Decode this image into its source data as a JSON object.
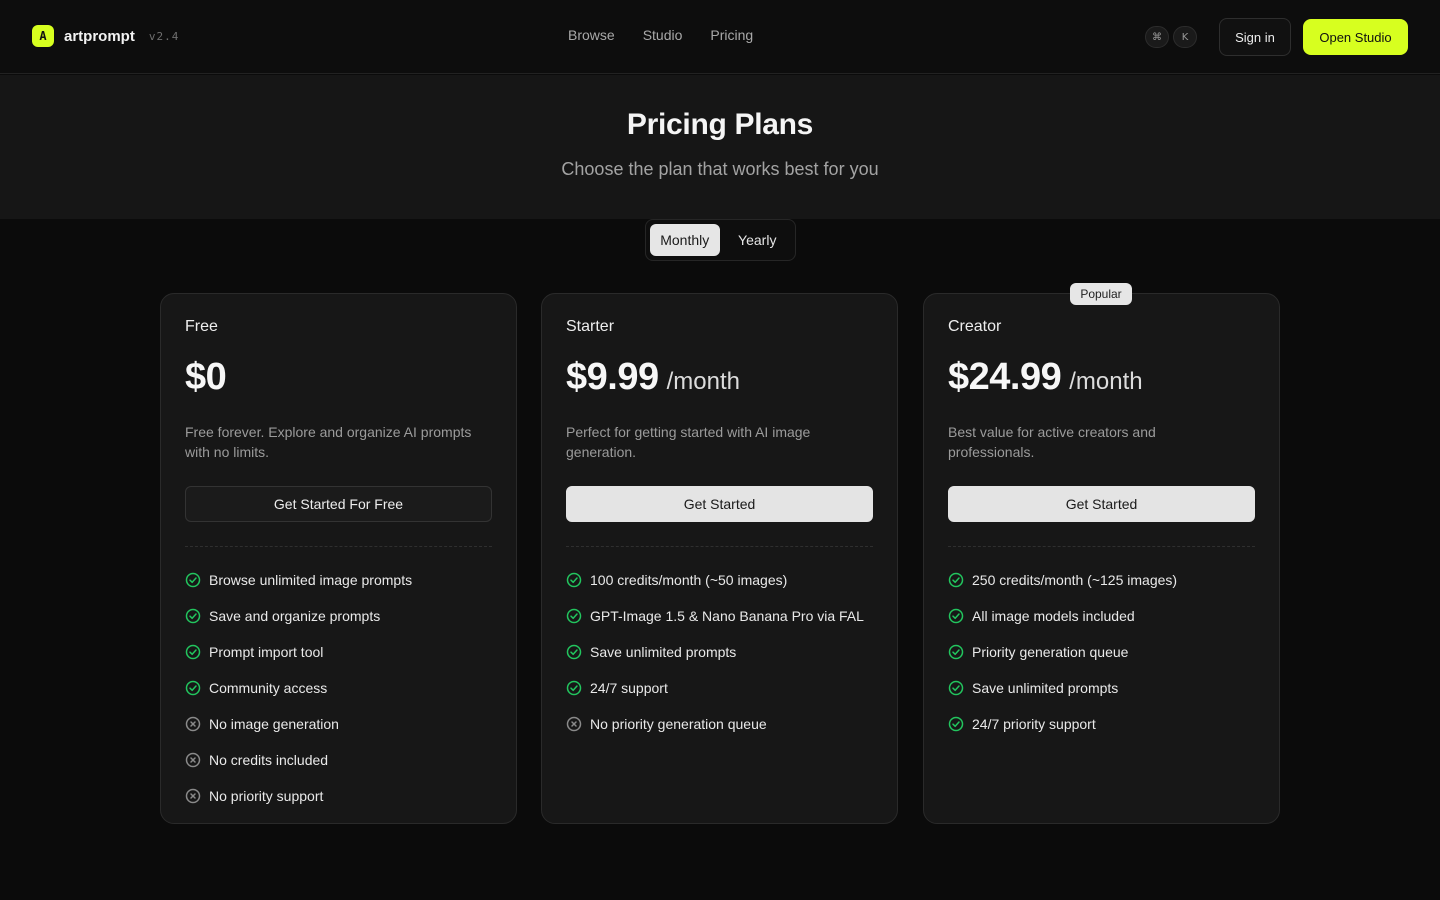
{
  "header": {
    "logo_letter": "A",
    "brand": "artprompt",
    "version": "v2.4",
    "nav": [
      "Browse",
      "Studio",
      "Pricing"
    ],
    "shortcut_keys": [
      "⌘",
      "K"
    ],
    "sign_in": "Sign in",
    "open_studio": "Open Studio"
  },
  "hero": {
    "title": "Pricing Plans",
    "subtitle": "Choose the plan that works best for you"
  },
  "billing_toggle": {
    "options": [
      "Monthly",
      "Yearly"
    ],
    "selected": "Monthly"
  },
  "plans": [
    {
      "name": "Free",
      "price": "$0",
      "period": "",
      "description": "Free forever. Explore and organize AI prompts with no limits.",
      "cta": "Get Started For Free",
      "features": [
        {
          "text": "Browse unlimited image prompts",
          "included": true
        },
        {
          "text": "Save and organize prompts",
          "included": true
        },
        {
          "text": "Prompt import tool",
          "included": true
        },
        {
          "text": "Community access",
          "included": true
        },
        {
          "text": "No image generation",
          "included": false
        },
        {
          "text": "No credits included",
          "included": false
        },
        {
          "text": "No priority support",
          "included": false
        }
      ]
    },
    {
      "name": "Starter",
      "price": "$9.99",
      "period": "/month",
      "description": "Perfect for getting started with AI image generation.",
      "cta": "Get Started",
      "features": [
        {
          "text": "100 credits/month (~50 images)",
          "included": true
        },
        {
          "text": "GPT-Image 1.5 & Nano Banana Pro via FAL",
          "included": true
        },
        {
          "text": "Save unlimited prompts",
          "included": true
        },
        {
          "text": "24/7 support",
          "included": true
        },
        {
          "text": "No priority generation queue",
          "included": false
        }
      ]
    },
    {
      "name": "Creator",
      "badge": "Popular",
      "price": "$24.99",
      "period": "/month",
      "description": "Best value for active creators and professionals.",
      "cta": "Get Started",
      "features": [
        {
          "text": "250 credits/month (~125 images)",
          "included": true
        },
        {
          "text": "All image models included",
          "included": true
        },
        {
          "text": "Priority generation queue",
          "included": true
        },
        {
          "text": "Save unlimited prompts",
          "included": true
        },
        {
          "text": "24/7 priority support",
          "included": true
        }
      ]
    }
  ],
  "colors": {
    "accent": "#d7ff1f",
    "check": "#22c55e",
    "cross": "#8a8a8a",
    "background": "#0b0b0b",
    "card": "#171717"
  }
}
